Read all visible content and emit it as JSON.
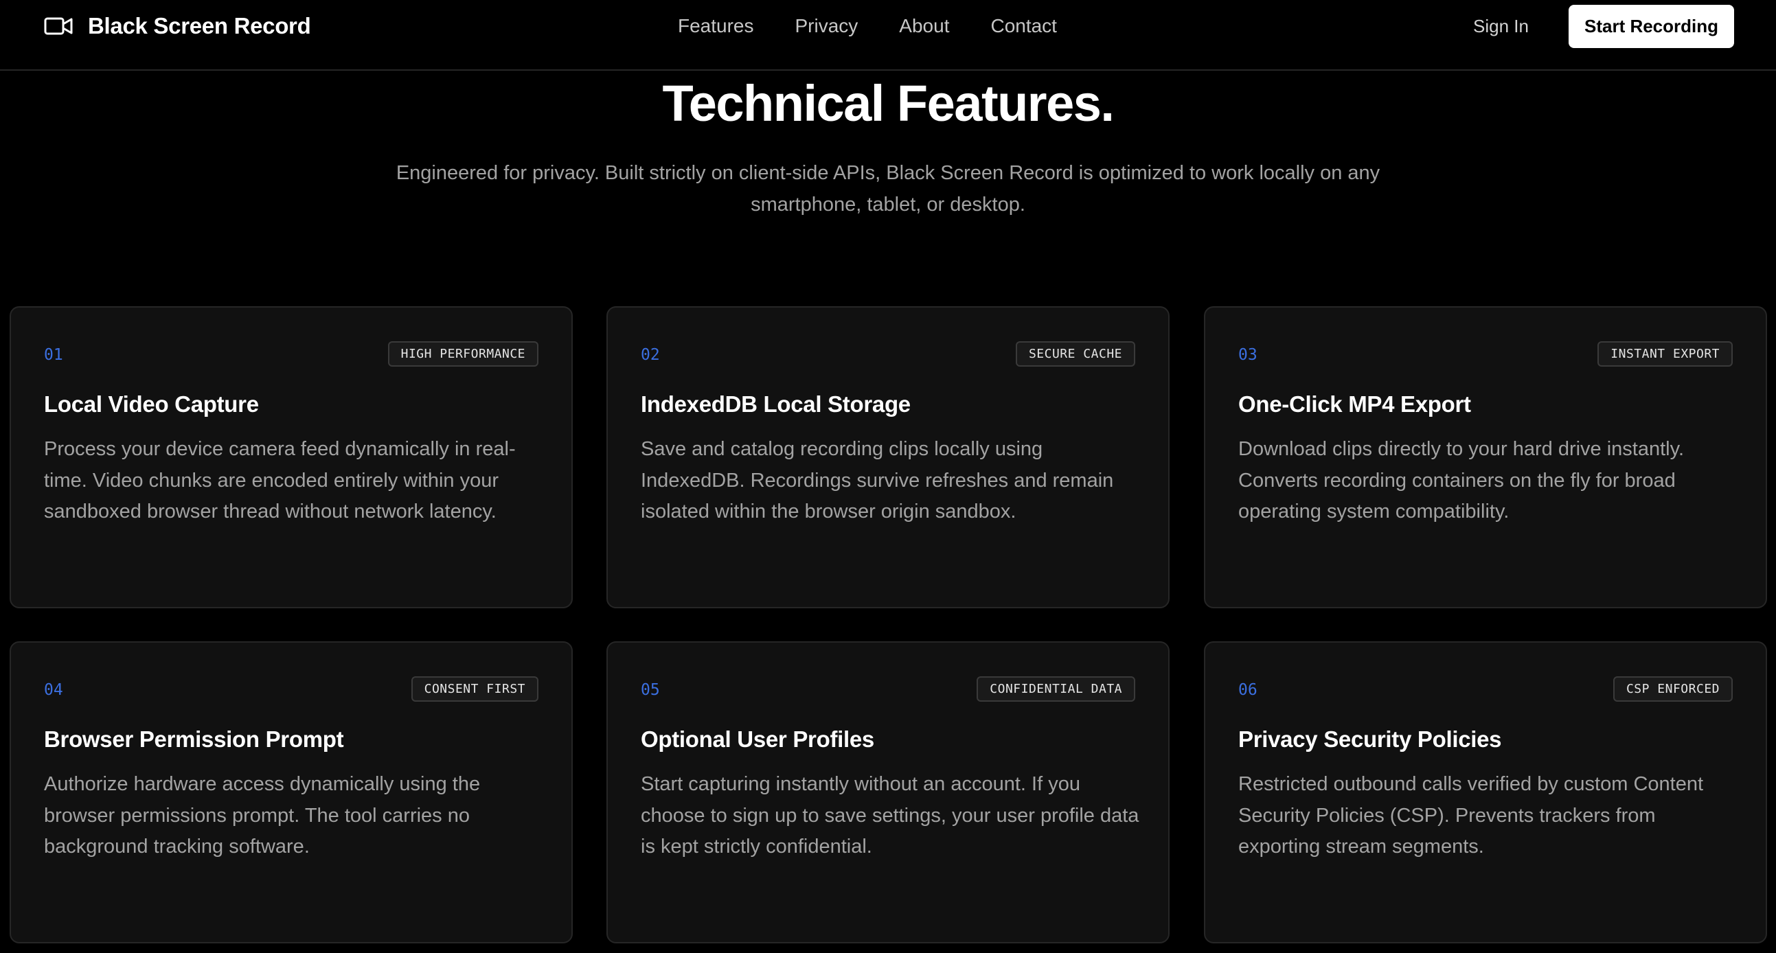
{
  "navbar": {
    "brand": "Black Screen Record",
    "links": [
      "Features",
      "Privacy",
      "About",
      "Contact"
    ],
    "sign_in": "Sign In",
    "cta": "Start Recording"
  },
  "hero": {
    "title": "Technical Features.",
    "subtitle": "Engineered for privacy. Built strictly on client-side APIs, Black Screen Record is optimized to work locally on any smartphone, tablet, or desktop."
  },
  "features": [
    {
      "number": "01",
      "badge": "HIGH PERFORMANCE",
      "title": "Local Video Capture",
      "description": "Process your device camera feed dynamically in real-time. Video chunks are encoded entirely within your sandboxed browser thread without network latency."
    },
    {
      "number": "02",
      "badge": "SECURE CACHE",
      "title": "IndexedDB Local Storage",
      "description": "Save and catalog recording clips locally using IndexedDB. Recordings survive refreshes and remain isolated within the browser origin sandbox."
    },
    {
      "number": "03",
      "badge": "INSTANT EXPORT",
      "title": "One-Click MP4 Export",
      "description": "Download clips directly to your hard drive instantly. Converts recording containers on the fly for broad operating system compatibility."
    },
    {
      "number": "04",
      "badge": "CONSENT FIRST",
      "title": "Browser Permission Prompt",
      "description": "Authorize hardware access dynamically using the browser permissions prompt. The tool carries no background tracking software."
    },
    {
      "number": "05",
      "badge": "CONFIDENTIAL DATA",
      "title": "Optional User Profiles",
      "description": "Start capturing instantly without an account. If you choose to sign up to save settings, your user profile data is kept strictly confidential."
    },
    {
      "number": "06",
      "badge": "CSP ENFORCED",
      "title": "Privacy Security Policies",
      "description": "Restricted outbound calls verified by custom Content Security Policies (CSP). Prevents trackers from exporting stream segments."
    }
  ],
  "colors": {
    "background": "#000000",
    "card_background": "#111111",
    "accent_number": "#3b6fe0",
    "text_muted": "#a3a3a3"
  },
  "icons": {
    "brand": "video-camera-icon"
  }
}
